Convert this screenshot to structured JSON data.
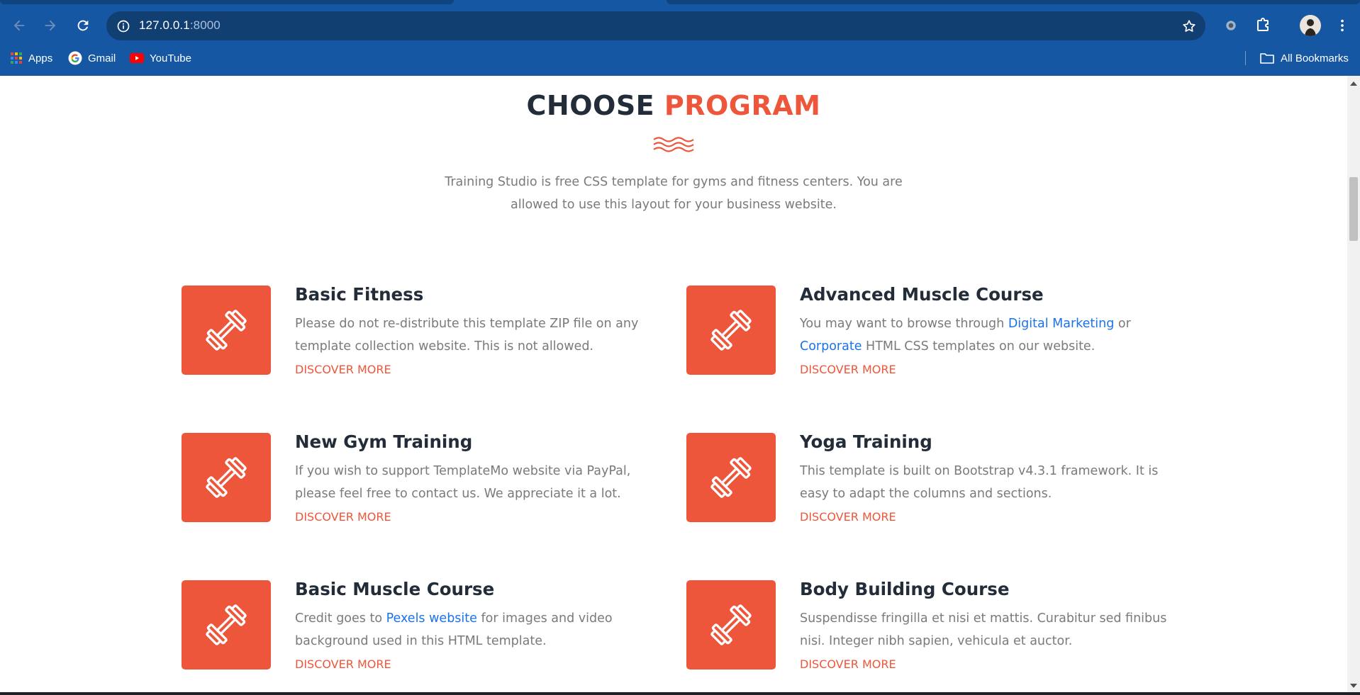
{
  "browser": {
    "url_host": "127.0.0.1",
    "url_port": ":8000",
    "bookmarks": [
      {
        "label": "Apps"
      },
      {
        "label": "Gmail"
      },
      {
        "label": "YouTube"
      }
    ],
    "all_bookmarks_label": "All Bookmarks",
    "colors": {
      "chrome": "#1657a3",
      "omnibox": "#123f72"
    }
  },
  "section": {
    "title_part1": "CHOOSE",
    "title_part2": "PROGRAM",
    "intro_line1": "Training Studio is free CSS template for gyms and fitness centers. You are",
    "intro_line2": "allowed to use this layout for your business website.",
    "accent_color": "#ed563b",
    "heading_color": "#232d39"
  },
  "programs": [
    {
      "title": "Basic Fitness",
      "line1": "Please do not re-distribute this template ZIP file on any",
      "line2": "template collection website. This is not allowed.",
      "link_label": "DISCOVER MORE",
      "icon": "dumbbell-icon"
    },
    {
      "title": "Advanced Muscle Course",
      "line1_pre": "You may want to browse through ",
      "line1_link": "Digital Marketing",
      "line1_post": " or",
      "line2_link": "Corporate",
      "line2_post": " HTML CSS templates on our website.",
      "link_label": "DISCOVER MORE",
      "icon": "dumbbell-icon"
    },
    {
      "title": "New Gym Training",
      "line1": "If you wish to support TemplateMo website via PayPal,",
      "line2": "please feel free to contact us. We appreciate it a lot.",
      "link_label": "DISCOVER MORE",
      "icon": "dumbbell-icon"
    },
    {
      "title": "Yoga Training",
      "line1": "This template is built on Bootstrap v4.3.1 framework. It is",
      "line2": "easy to adapt the columns and sections.",
      "link_label": "DISCOVER MORE",
      "icon": "dumbbell-icon"
    },
    {
      "title": "Basic Muscle Course",
      "line1_pre": "Credit goes to ",
      "line1_link": "Pexels website",
      "line1_post": " for images and video",
      "line2": "background used in this HTML template.",
      "link_label": "DISCOVER MORE",
      "icon": "dumbbell-icon"
    },
    {
      "title": "Body Building Course",
      "line1": "Suspendisse fringilla et nisi et mattis. Curabitur sed finibus",
      "line2": "nisi. Integer nibh sapien, vehicula et auctor.",
      "link_label": "DISCOVER MORE",
      "icon": "dumbbell-icon"
    }
  ]
}
